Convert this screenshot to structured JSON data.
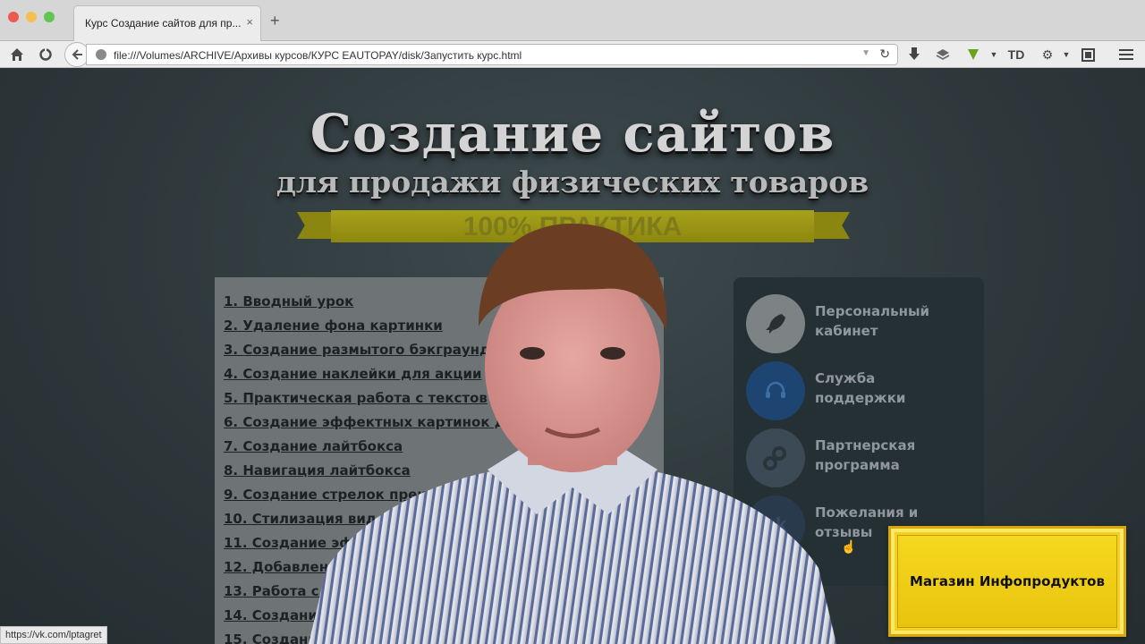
{
  "browser": {
    "tab_title": "Курс Создание сайтов для пр...",
    "tab_close": "×",
    "new_tab": "+",
    "url": "file:///Volumes/ARCHIVE/Архивы курсов/КУРС EAUTOPAY/disk/Запустить курс.html",
    "toolbar_icons": [
      "home-icon",
      "sync-icon",
      "back-icon",
      "reload-icon",
      "download-icon",
      "pocket-icon",
      "addon-icon",
      "td-icon",
      "screenshot-icon",
      "menu-icon"
    ]
  },
  "header": {
    "title": "Создание сайтов",
    "subtitle": "для продажи физических товаров",
    "ribbon": "100% ПРАКТИКА",
    "ribbon_color": "#a7a21a"
  },
  "lessons": [
    "1. Вводный урок",
    "2. Удаление фона картинки",
    "3. Создание размытого бэкграунда",
    "4. Создание наклейки для акции",
    "5. Практическая работа с текстов",
    "6. Создание эффектных картинок д",
    "7. Создание лайтбокса",
    "8. Навигация лайтбокса",
    "9. Создание стрелок преимуществ",
    "10. Стилизация видеоро",
    "11. Создание эфф",
    "12. Добавление",
    "13. Работа с г",
    "14. Создание",
    "15. Создани"
  ],
  "menu": [
    {
      "label": "Персональный кабинет",
      "icon": "rocket-icon"
    },
    {
      "label": "Служба поддержки",
      "icon": "headset-icon"
    },
    {
      "label": "Партнерская программа",
      "icon": "gears-icon"
    },
    {
      "label": "Пожелания и отзывы",
      "icon": "vk-icon"
    }
  ],
  "badge": {
    "text": "Магазин Инфопродуктов",
    "color": "#f3d21d"
  },
  "status_bar": {
    "link": "https://vk.com/lptagret"
  }
}
